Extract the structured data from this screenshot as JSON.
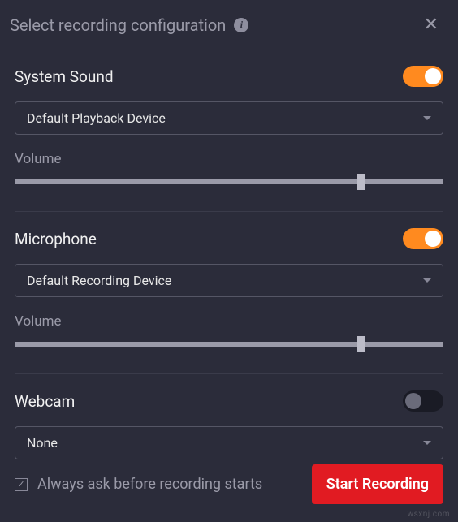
{
  "header": {
    "title": "Select recording configuration"
  },
  "system_sound": {
    "title": "System Sound",
    "toggle": true,
    "device": "Default Playback Device",
    "volume_label": "Volume",
    "volume_percent": 80
  },
  "microphone": {
    "title": "Microphone",
    "toggle": true,
    "device": "Default Recording Device",
    "volume_label": "Volume",
    "volume_percent": 80
  },
  "webcam": {
    "title": "Webcam",
    "toggle": false,
    "device": "None"
  },
  "footer": {
    "always_ask_checked": true,
    "always_ask_label": "Always ask before recording starts",
    "start_label": "Start Recording"
  },
  "colors": {
    "accent": "#ff8a1f",
    "danger": "#e11b22",
    "bg": "#2b2c3a"
  },
  "watermark": "wsxnj.com"
}
